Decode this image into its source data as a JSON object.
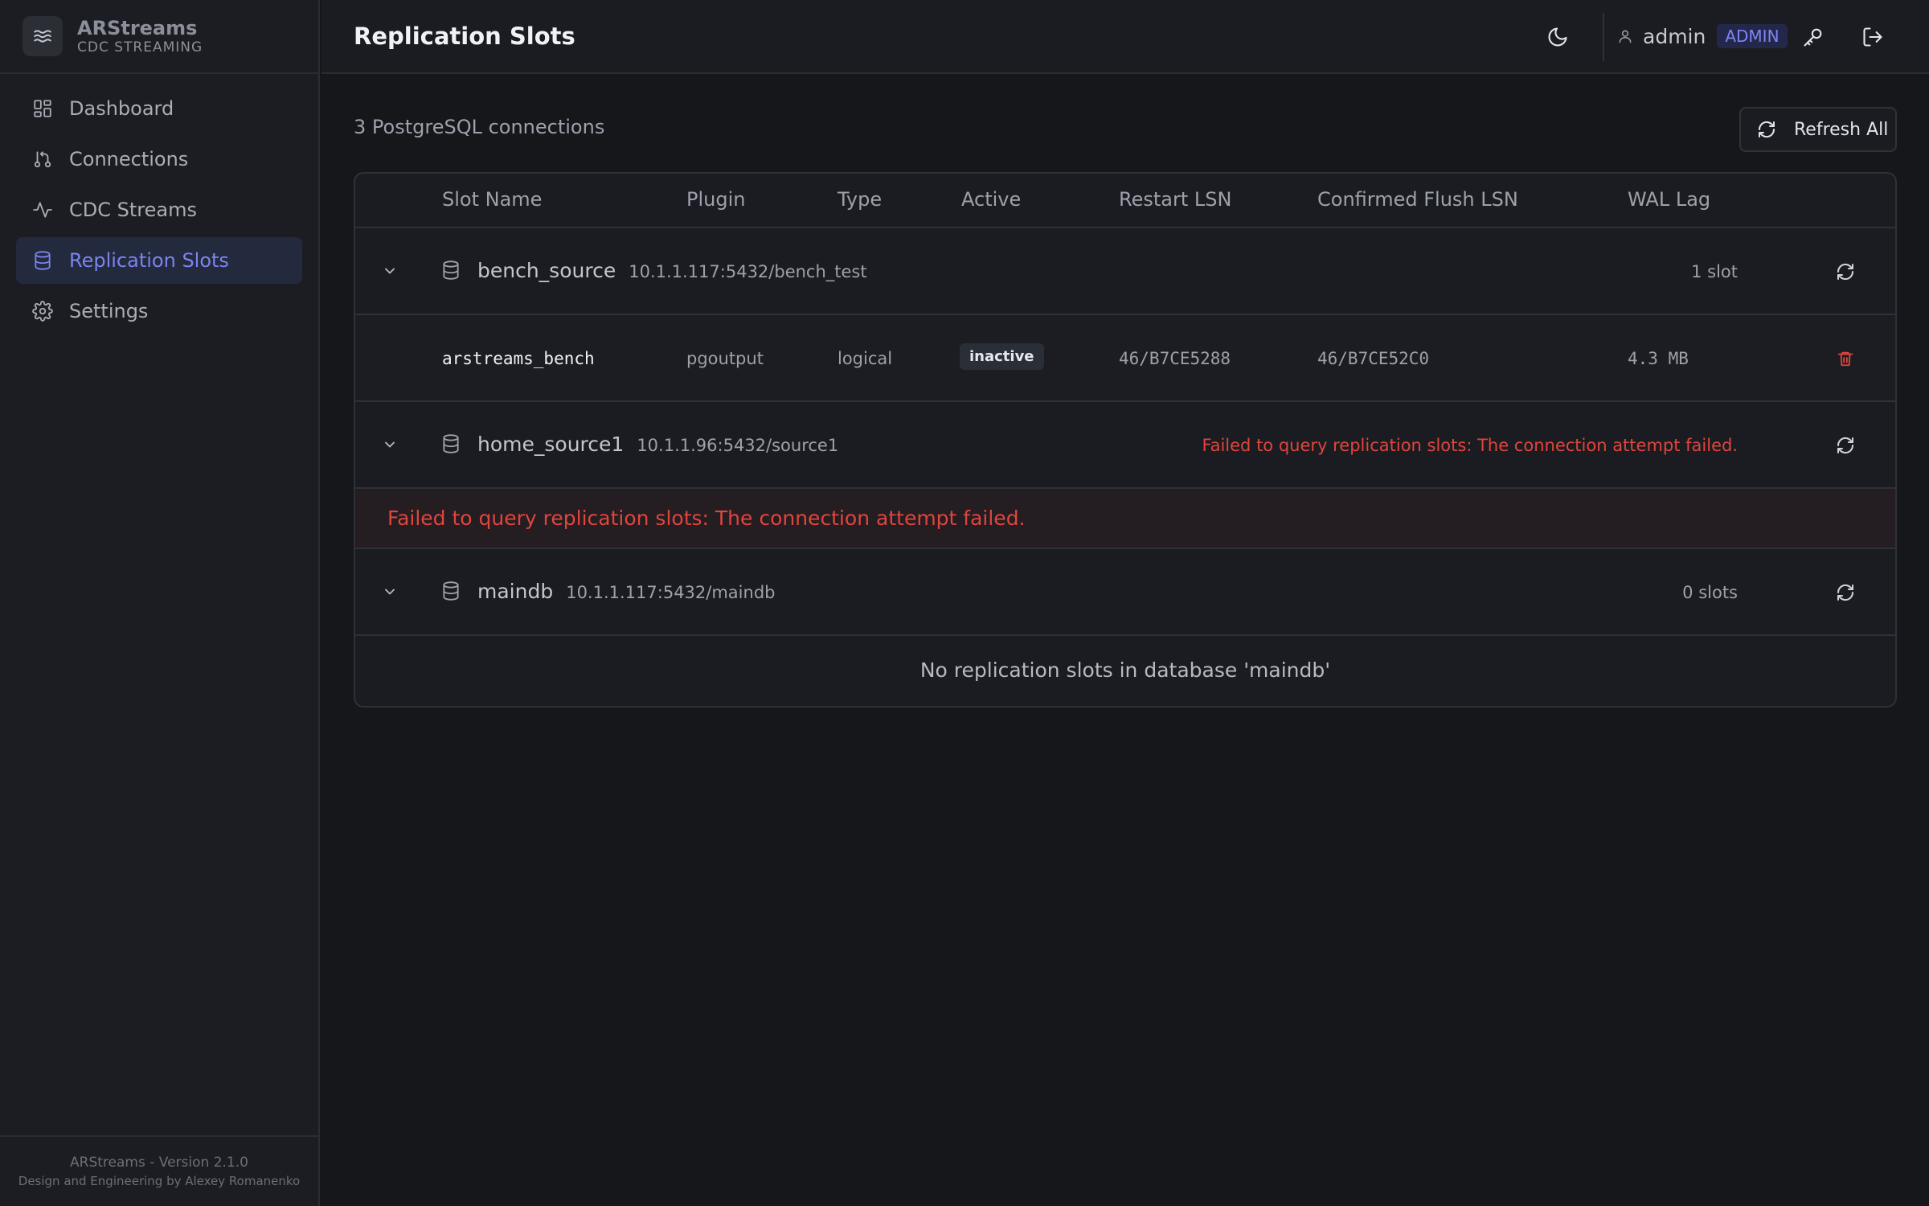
{
  "app": {
    "name": "ARStreams",
    "subtitle": "CDC STREAMING",
    "version": "ARStreams - Version 2.1.0",
    "credits": "Design and Engineering by Alexey Romanenko"
  },
  "nav": {
    "items": [
      {
        "label": "Dashboard",
        "icon": "dashboard-icon"
      },
      {
        "label": "Connections",
        "icon": "connections-icon"
      },
      {
        "label": "CDC Streams",
        "icon": "activity-icon"
      },
      {
        "label": "Replication Slots",
        "icon": "database-icon",
        "active": true
      },
      {
        "label": "Settings",
        "icon": "gear-icon"
      }
    ]
  },
  "header": {
    "title": "Replication Slots",
    "user": "admin",
    "role": "ADMIN"
  },
  "main": {
    "summary": "3 PostgreSQL connections",
    "refresh_all_label": "Refresh All",
    "columns": [
      "Slot Name",
      "Plugin",
      "Type",
      "Active",
      "Restart LSN",
      "Confirmed Flush LSN",
      "WAL Lag"
    ],
    "groups": [
      {
        "name": "bench_source",
        "host": "10.1.1.117:5432/bench_test",
        "slot_count": "1 slot",
        "slots": [
          {
            "name": "arstreams_bench",
            "plugin": "pgoutput",
            "type": "logical",
            "active": "inactive",
            "restart_lsn": "46/B7CE5288",
            "confirmed_flush_lsn": "46/B7CE52C0",
            "wal_lag": "4.3 MB"
          }
        ]
      },
      {
        "name": "home_source1",
        "host": "10.1.1.96:5432/source1",
        "inline_error": "Failed to query replication slots: The connection attempt failed.",
        "error": "Failed to query replication slots: The connection attempt failed."
      },
      {
        "name": "maindb",
        "host": "10.1.1.117:5432/maindb",
        "slot_count": "0 slots",
        "empty_message": "No replication slots in database 'maindb'"
      }
    ]
  },
  "colors": {
    "accent": "#7b84f0",
    "error": "#e0453d",
    "background": "#16171b",
    "sidebar": "#1c1d22"
  }
}
